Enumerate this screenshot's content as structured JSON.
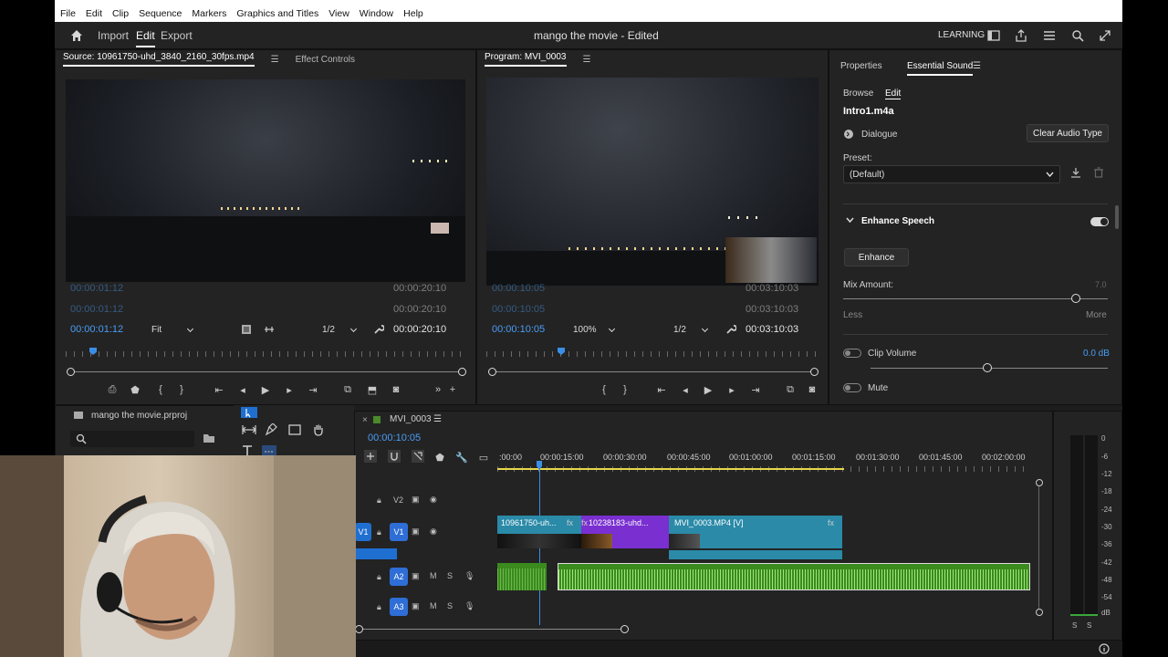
{
  "menu": [
    "File",
    "Edit",
    "Clip",
    "Sequence",
    "Markers",
    "Graphics and Titles",
    "View",
    "Window",
    "Help"
  ],
  "header": {
    "workspaces": [
      "Import",
      "Edit",
      "Export"
    ],
    "active_workspace": "Edit",
    "project_title": "mango the movie - Edited",
    "learning": "LEARNING"
  },
  "source_monitor": {
    "tab": "Source: 10961750-uhd_3840_2160_30fps.mp4",
    "tab2": "Effect Controls",
    "timecode": "00:00:01:12",
    "fit": "Fit",
    "res": "1/2",
    "duration": "00:00:20:10"
  },
  "program_monitor": {
    "tab": "Program: MVI_0003",
    "timecode": "00:00:10:05",
    "zoom": "100%",
    "res": "1/2",
    "duration": "00:03:10:03"
  },
  "essential_sound": {
    "tab_properties": "Properties",
    "tab_essential": "Essential Sound",
    "browse": "Browse",
    "edit": "Edit",
    "clip_name": "Intro1.m4a",
    "type": "Dialogue",
    "clear_button": "Clear Audio Type",
    "preset_label": "Preset:",
    "preset_value": "(Default)",
    "enhance_speech": "Enhance Speech",
    "enhance_button": "Enhance",
    "mix_amount": "Mix Amount:",
    "mix_value": "7.0",
    "mix_fraction": 0.88,
    "less": "Less",
    "more": "More",
    "clip_volume": "Clip Volume",
    "clip_volume_value": "0.0 dB",
    "mute": "Mute"
  },
  "project": {
    "name": "mango the movie.prproj"
  },
  "timeline": {
    "sequence": "MVI_0003",
    "timecode": "00:00:10:05",
    "ticks": [
      ":00:00",
      "00:00:15:00",
      "00:00:30:00",
      "00:00:45:00",
      "00:01:00:00",
      "00:01:15:00",
      "00:01:30:00",
      "00:01:45:00",
      "00:02:00:00"
    ],
    "tracks": {
      "v2": "V2",
      "v1": "V1",
      "v1_src": "V1",
      "a2": "A2",
      "a3": "A3",
      "m": "M",
      "s": "S"
    },
    "clips": {
      "c1": "10961750-uh...",
      "c2": "10238183-uhd...",
      "c3": "MVI_0003.MP4 [V]",
      "fx": "fx"
    }
  },
  "meters": {
    "scale": [
      "0",
      "-6",
      "-12",
      "-18",
      "-24",
      "-30",
      "-36",
      "-42",
      "-48",
      "-54",
      "dB"
    ],
    "s1": "S",
    "s2": "S"
  },
  "colors": {
    "accent_blue": "#4a9df6",
    "clip_teal": "#2a8aa8",
    "clip_purple": "#7a2fd0",
    "audio_green": "#3a8a1e"
  }
}
